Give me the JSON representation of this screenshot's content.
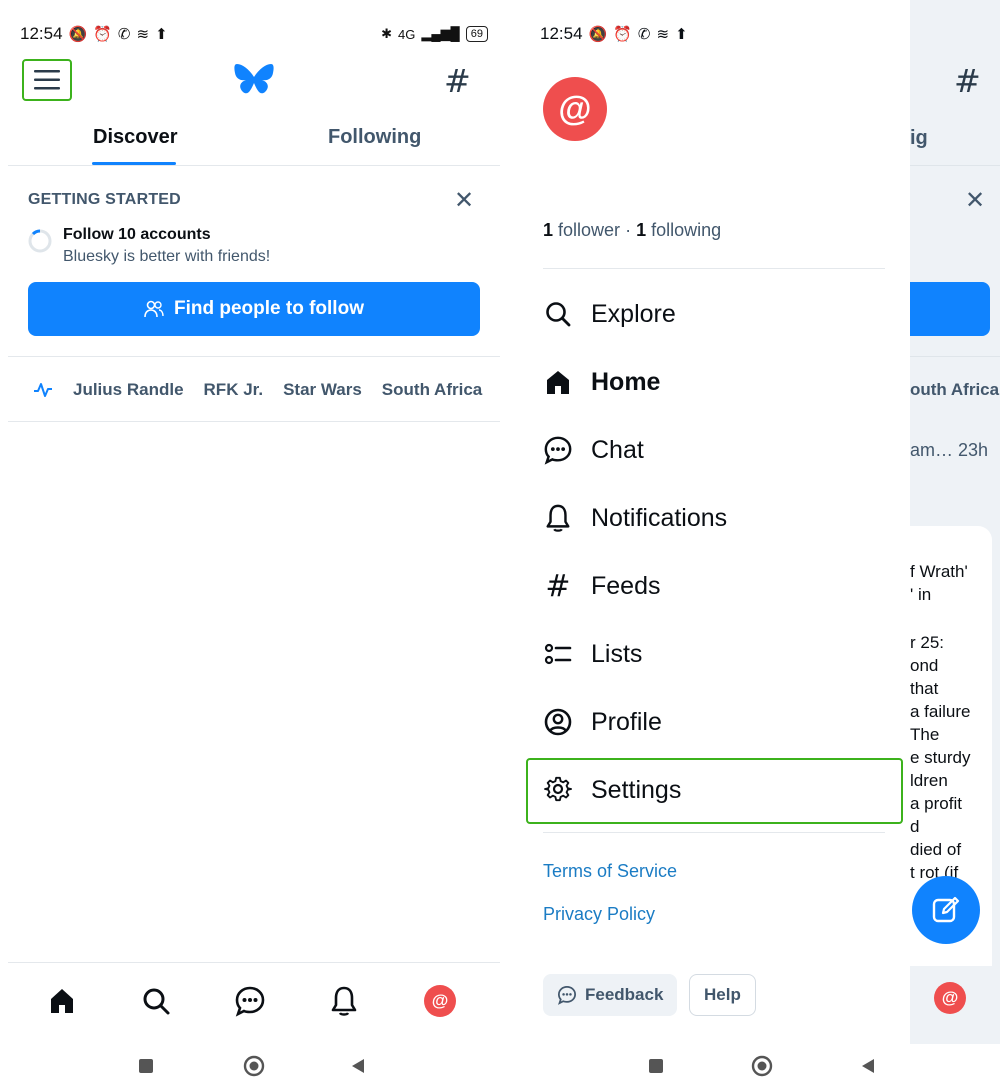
{
  "status_bar": {
    "time": "12:54",
    "network": "4G",
    "battery": "69"
  },
  "left": {
    "tabs": [
      {
        "label": "Discover"
      },
      {
        "label": "Following"
      }
    ],
    "getting_started": {
      "title": "GETTING STARTED",
      "task_title": "Follow 10 accounts",
      "task_subtitle": "Bluesky is better with friends!",
      "button_label": "Find people to follow"
    },
    "trending": [
      "Julius Randle",
      "RFK Jr.",
      "Star Wars",
      "South Africa"
    ],
    "avatar_glyph": "@"
  },
  "right": {
    "avatar_glyph": "@",
    "followers_count": "1",
    "followers_label": "follower",
    "separator": "·",
    "following_count": "1",
    "following_label": "following",
    "menu": [
      {
        "label": "Explore",
        "icon": "search-icon"
      },
      {
        "label": "Home",
        "icon": "home-icon"
      },
      {
        "label": "Chat",
        "icon": "chat-icon"
      },
      {
        "label": "Notifications",
        "icon": "bell-icon"
      },
      {
        "label": "Feeds",
        "icon": "hash-icon"
      },
      {
        "label": "Lists",
        "icon": "list-icon"
      },
      {
        "label": "Profile",
        "icon": "profile-icon"
      },
      {
        "label": "Settings",
        "icon": "gear-icon"
      }
    ],
    "links": {
      "terms": "Terms of Service",
      "privacy": "Privacy Policy"
    },
    "buttons": {
      "feedback": "Feedback",
      "help": "Help"
    },
    "behind": {
      "tab_fragment": "ig",
      "trend_fragment": "outh Africa",
      "post_header": "am… 23h",
      "post_lines": [
        "f Wrath'",
        "' in",
        "",
        "r 25:",
        "ond",
        " that",
        "a failure",
        "The",
        "e sturdy",
        "ldren",
        "a profit",
        "d",
        " died of",
        "t rot (if"
      ]
    }
  },
  "colors": {
    "accent": "#1083fe",
    "highlight": "#3cb21c",
    "avatar": "#ef4e4e",
    "muted": "#42576c"
  }
}
